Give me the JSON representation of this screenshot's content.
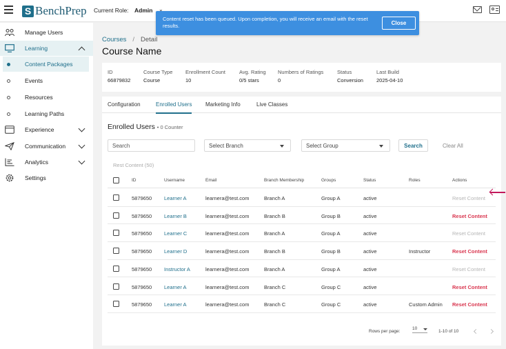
{
  "header": {
    "logo_text": "BenchPrep",
    "role_label": "Current Role:",
    "role_value": "Admin",
    "icons": [
      "hamburger-icon",
      "mail-icon",
      "contact-card-icon"
    ]
  },
  "toast": {
    "message": "Content reset has been queued. Upon completion, you will receive an email with the reset results.",
    "close_label": "Close",
    "color": "#3d8fe0"
  },
  "sidebar": {
    "items": [
      {
        "label": "Manage Users",
        "icon": "users-icon"
      },
      {
        "label": "Learning",
        "icon": "monitor-icon",
        "expanded": true
      },
      {
        "label": "Content Packages",
        "active": true
      },
      {
        "label": "Events"
      },
      {
        "label": "Resources"
      },
      {
        "label": "Learning Paths"
      },
      {
        "label": "Experience",
        "icon": "calendar-icon"
      },
      {
        "label": "Communication",
        "icon": "send-icon"
      },
      {
        "label": "Analytics",
        "icon": "chart-icon"
      },
      {
        "label": "Settings",
        "icon": "gear-icon"
      }
    ]
  },
  "breadcrumb": {
    "link": "Courses",
    "sep": "/",
    "current": "Detail"
  },
  "page_title": "Course Name",
  "info": [
    {
      "key": "ID",
      "value": "66879832"
    },
    {
      "key": "Course Type",
      "value": "Course"
    },
    {
      "key": "Enrollment Count",
      "value": "10"
    },
    {
      "key": "Avg. Rating",
      "value": "0/5 stars"
    },
    {
      "key": "Numbers of Ratings",
      "value": "0"
    },
    {
      "key": "Status",
      "value": "Conversion"
    },
    {
      "key": "Last Build",
      "value": "2025-04-10"
    }
  ],
  "tabs": [
    {
      "label": "Configuration"
    },
    {
      "label": "Enrolled Users",
      "active": true
    },
    {
      "label": "Marketing Info"
    },
    {
      "label": "Live Classes"
    }
  ],
  "enrolled": {
    "title": "Enrolled Users",
    "counter": "• 0 Counter",
    "search_placeholder": "Search",
    "branch_select": "Select Branch",
    "group_select": "Select Group",
    "search_button": "Search",
    "clear_button": "Clear All",
    "reset_all": "Rest Content (50)"
  },
  "table": {
    "columns": [
      "ID",
      "Username",
      "Email",
      "Branch Membership",
      "Groups",
      "Status",
      "Roles",
      "Actions"
    ],
    "rows": [
      {
        "id": "5879650",
        "username": "Learner A",
        "email": "learnera@test.com",
        "branch": "Branch A",
        "group": "Group A",
        "status": "active",
        "role": "",
        "action": "Reset Content",
        "enabled": false
      },
      {
        "id": "5879650",
        "username": "Learner B",
        "email": "learnera@test.com",
        "branch": "Branch B",
        "group": "Group B",
        "status": "active",
        "role": "",
        "action": "Reset Content",
        "enabled": true
      },
      {
        "id": "5879650",
        "username": "Learner C",
        "email": "learnera@test.com",
        "branch": "Branch A",
        "group": "Group A",
        "status": "active",
        "role": "",
        "action": "Reset Content",
        "enabled": false
      },
      {
        "id": "5879650",
        "username": "Learner D",
        "email": "learnera@test.com",
        "branch": "Branch B",
        "group": "Group B",
        "status": "active",
        "role": "Instructor",
        "action": "Reset Content",
        "enabled": true
      },
      {
        "id": "5879650",
        "username": "Instructor A",
        "email": "learnera@test.com",
        "branch": "Branch A",
        "group": "Group A",
        "status": "active",
        "role": "",
        "action": "Reset Content",
        "enabled": false
      },
      {
        "id": "5879650",
        "username": "Learner A",
        "email": "learnera@test.com",
        "branch": "Branch C",
        "group": "Group C",
        "status": "active",
        "role": "",
        "action": "Reset Content",
        "enabled": true
      },
      {
        "id": "5879650",
        "username": "Learner A",
        "email": "learnera@test.com",
        "branch": "Branch C",
        "group": "Group C",
        "status": "active",
        "role": "Custom Admin",
        "action": "Reset Content",
        "enabled": true
      }
    ]
  },
  "pagination": {
    "rows_label": "Rows per page:",
    "rows_value": "10",
    "range": "1-10 of 10"
  },
  "colors": {
    "accent": "#1f6f8b",
    "danger": "#d9364f",
    "annotation_arrow": "#c2185b"
  }
}
